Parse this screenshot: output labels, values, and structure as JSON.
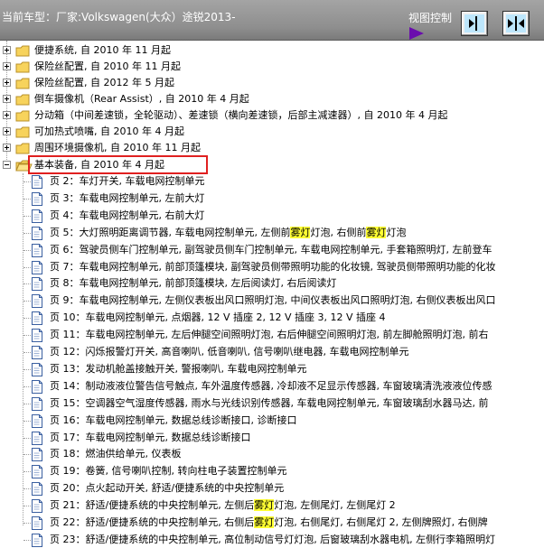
{
  "header": {
    "title": "当前车型：厂家:Volkswagen(大众）途锐2013-",
    "view_control_label": "视图控制"
  },
  "folders": [
    {
      "label": "便捷系统, 自 2010 年 11 月起"
    },
    {
      "label": "保险丝配置, 自 2010 年 11 月起"
    },
    {
      "label": "保险丝配置, 自 2012 年 5 月起"
    },
    {
      "label": "倒车摄像机（Rear Assist）, 自 2010 年 4 月起"
    },
    {
      "label": "分动箱（中间差速锁，全轮驱动）、差速锁（横向差速锁，后部主减速器）, 自 2010 年 4 月起"
    },
    {
      "label": "可加热式喷嘴, 自 2010 年 4 月起"
    },
    {
      "label": "周围环境摄像机, 自 2010 年 11 月起"
    },
    {
      "label": "基本装备, 自 2010 年 4 月起"
    }
  ],
  "pages": [
    {
      "pre": "页 2：车灯开关, 车载电网控制单元",
      "hl1": "",
      "mid": "",
      "hl2": "",
      "post": ""
    },
    {
      "pre": "页 3：车载电网控制单元, 左前大灯",
      "hl1": "",
      "mid": "",
      "hl2": "",
      "post": ""
    },
    {
      "pre": "页 4：车载电网控制单元, 右前大灯",
      "hl1": "",
      "mid": "",
      "hl2": "",
      "post": ""
    },
    {
      "pre": "页 5：大灯照明距离调节器, 车载电网控制单元, 左侧前",
      "hl1": "雾灯",
      "mid": "灯泡, 右侧前",
      "hl2": "雾灯",
      "post": "灯泡"
    },
    {
      "pre": "页 6：驾驶员侧车门控制单元, 副驾驶员侧车门控制单元, 车载电网控制单元, 手套箱照明灯, 左前登车",
      "hl1": "",
      "mid": "",
      "hl2": "",
      "post": ""
    },
    {
      "pre": "页 7：车载电网控制单元, 前部顶篷模块, 副驾驶员侧带照明功能的化妆镜, 驾驶员侧带照明功能的化妆",
      "hl1": "",
      "mid": "",
      "hl2": "",
      "post": ""
    },
    {
      "pre": "页 8：车载电网控制单元, 前部顶篷模块, 左后阅读灯, 右后阅读灯",
      "hl1": "",
      "mid": "",
      "hl2": "",
      "post": ""
    },
    {
      "pre": "页 9：车载电网控制单元, 左侧仪表板出风口照明灯泡, 中间仪表板出风口照明灯泡, 右侧仪表板出风口",
      "hl1": "",
      "mid": "",
      "hl2": "",
      "post": ""
    },
    {
      "pre": "页 10：车载电网控制单元, 点烟器, 12 V 插座 2, 12 V 插座 3, 12 V 插座 4",
      "hl1": "",
      "mid": "",
      "hl2": "",
      "post": ""
    },
    {
      "pre": "页 11：车载电网控制单元, 左后伸腿空间照明灯泡, 右后伸腿空间照明灯泡, 前左脚舱照明灯泡, 前右",
      "hl1": "",
      "mid": "",
      "hl2": "",
      "post": ""
    },
    {
      "pre": "页 12：闪烁报警灯开关, 高音喇叭, 低音喇叭, 信号喇叭继电器, 车载电网控制单元",
      "hl1": "",
      "mid": "",
      "hl2": "",
      "post": ""
    },
    {
      "pre": "页 13：发动机舱盖接触开关, 警报喇叭, 车载电网控制单元",
      "hl1": "",
      "mid": "",
      "hl2": "",
      "post": ""
    },
    {
      "pre": "页 14：制动液液位警告信号触点, 车外温度传感器, 冷却液不足显示传感器, 车窗玻璃清洗液液位传感",
      "hl1": "",
      "mid": "",
      "hl2": "",
      "post": ""
    },
    {
      "pre": "页 15：空调器空气湿度传感器, 雨水与光线识别传感器, 车载电网控制单元, 车窗玻璃刮水器马达, 前",
      "hl1": "",
      "mid": "",
      "hl2": "",
      "post": ""
    },
    {
      "pre": "页 16：车载电网控制单元, 数据总线诊断接口, 诊断接口",
      "hl1": "",
      "mid": "",
      "hl2": "",
      "post": ""
    },
    {
      "pre": "页 17：车载电网控制单元, 数据总线诊断接口",
      "hl1": "",
      "mid": "",
      "hl2": "",
      "post": ""
    },
    {
      "pre": "页 18：燃油供给单元, 仪表板",
      "hl1": "",
      "mid": "",
      "hl2": "",
      "post": ""
    },
    {
      "pre": "页 19：卷簧, 信号喇叭控制, 转向柱电子装置控制单元",
      "hl1": "",
      "mid": "",
      "hl2": "",
      "post": ""
    },
    {
      "pre": "页 20：点火起动开关, 舒适/便捷系统的中央控制单元",
      "hl1": "",
      "mid": "",
      "hl2": "",
      "post": ""
    },
    {
      "pre": "页 21：舒适/便捷系统的中央控制单元, 左侧后",
      "hl1": "雾灯",
      "mid": "灯泡, 左侧尾灯, 左侧尾灯 2",
      "hl2": "",
      "post": ""
    },
    {
      "pre": "页 22：舒适/便捷系统的中央控制单元, 右侧后",
      "hl1": "雾灯",
      "mid": "灯泡, 右侧尾灯, 右侧尾灯 2, 左侧牌照灯, 右侧牌",
      "hl2": "",
      "post": ""
    },
    {
      "pre": "页 23：舒适/便捷系统的中央控制单元, 高位制动信号灯灯泡, 后窗玻璃刮水器电机, 左侧行李箱照明灯",
      "hl1": "",
      "mid": "",
      "hl2": "",
      "post": ""
    }
  ]
}
